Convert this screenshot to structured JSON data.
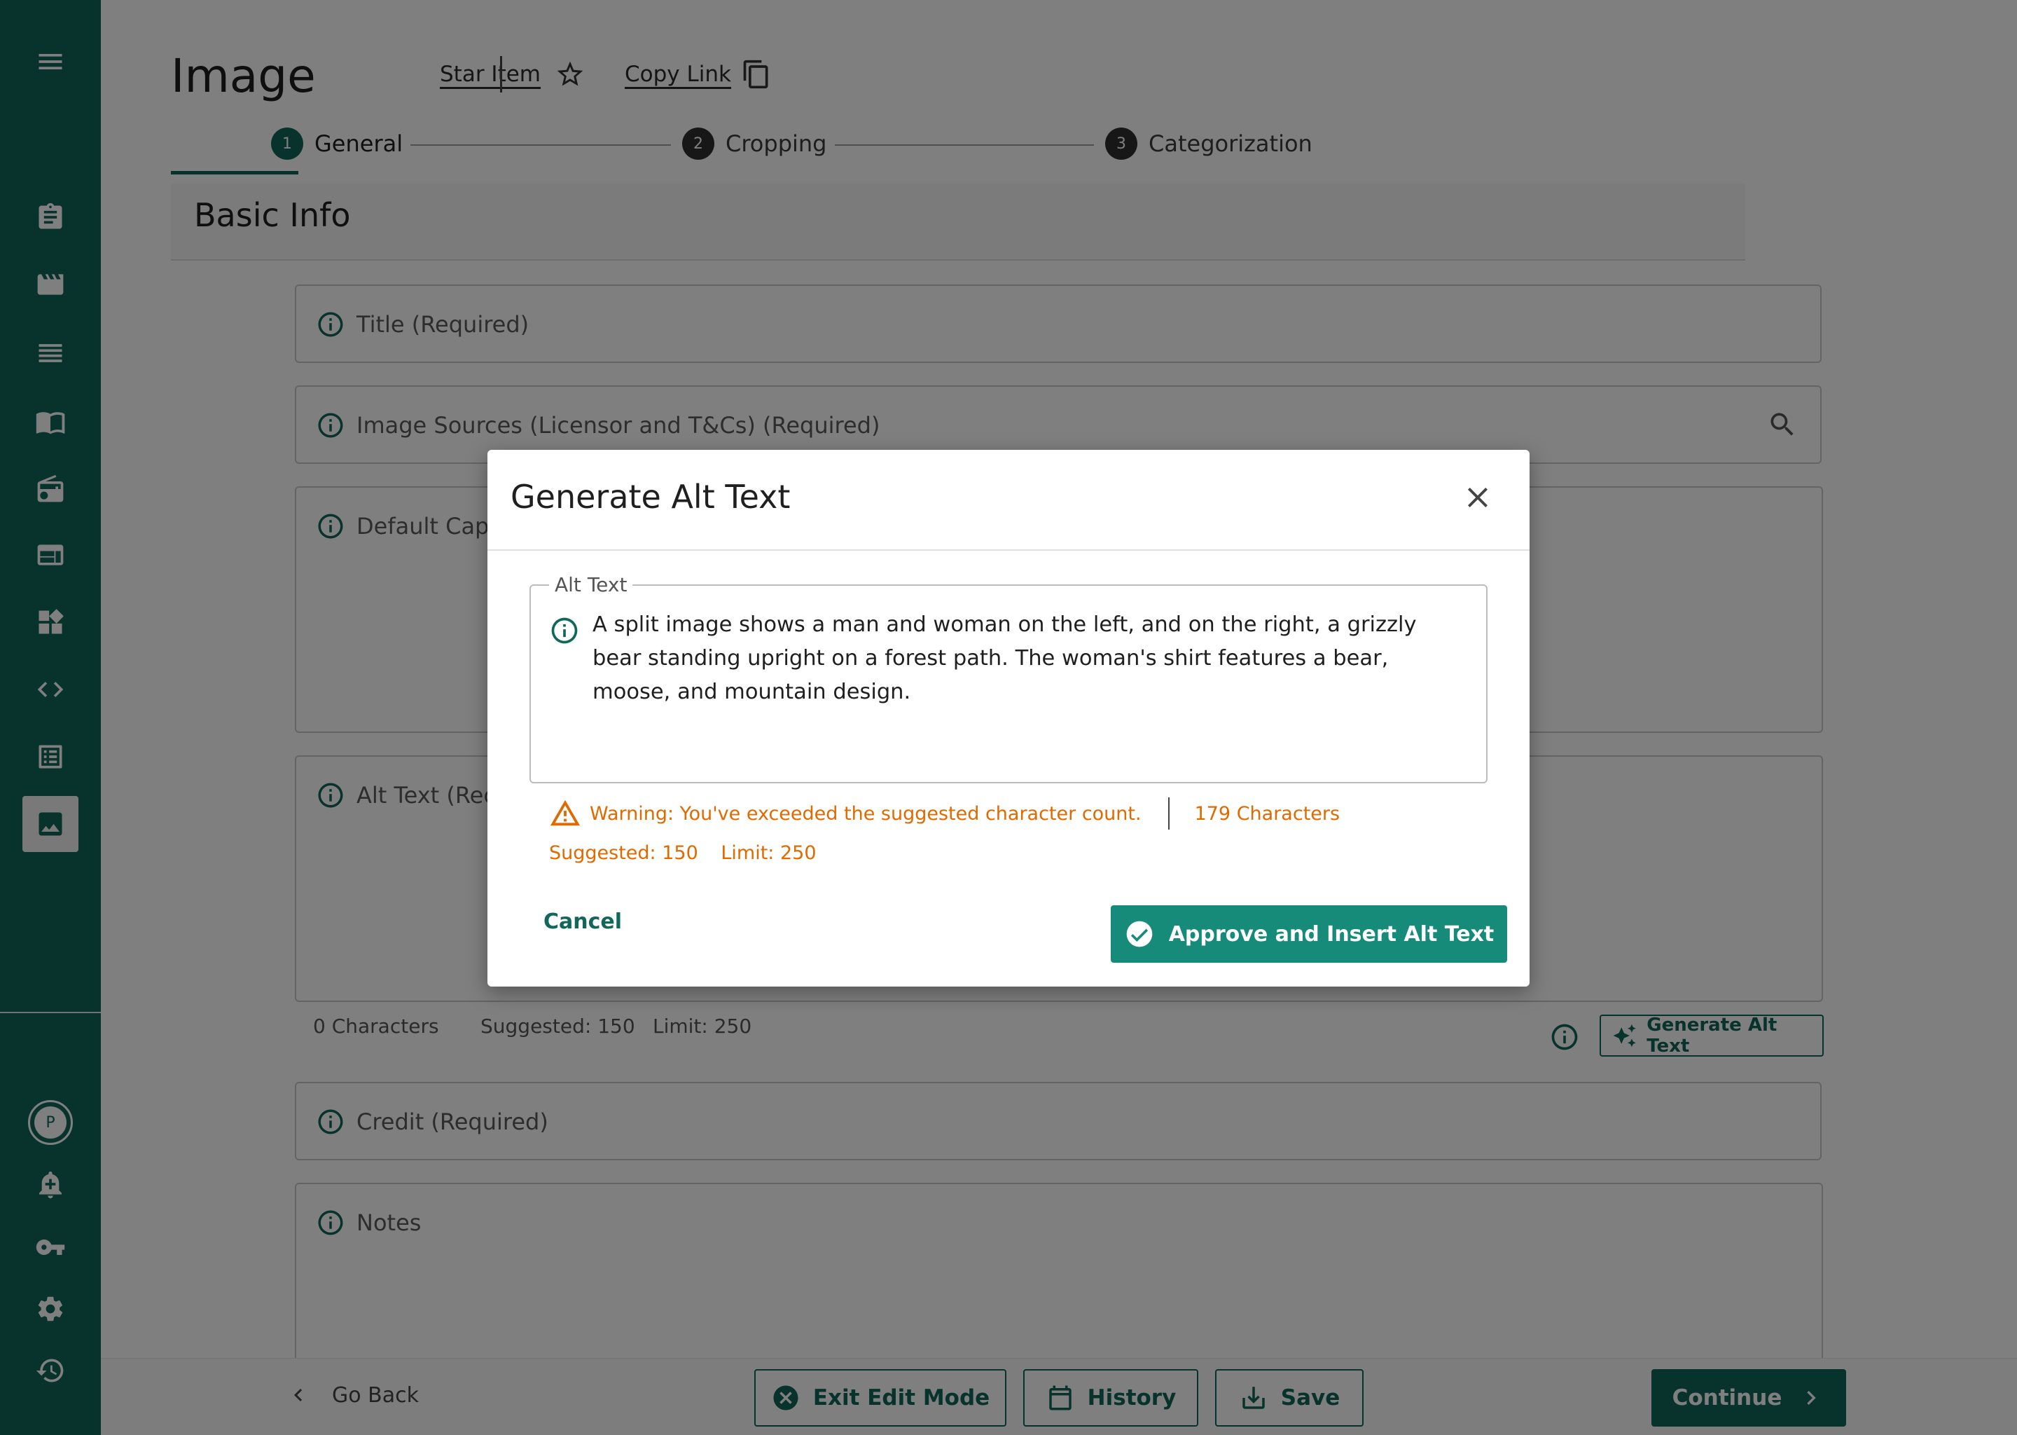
{
  "header": {
    "title": "Image",
    "star_item": "Star Item",
    "copy_link": "Copy Link"
  },
  "steps": [
    {
      "num": "1",
      "label": "General"
    },
    {
      "num": "2",
      "label": "Cropping"
    },
    {
      "num": "3",
      "label": "Categorization"
    }
  ],
  "section": {
    "title": "Basic Info"
  },
  "fields": {
    "title": "Title (Required)",
    "image_sources": "Image Sources (Licensor and T&Cs) (Required)",
    "default_caption": "Default Capt",
    "alt_text": "Alt Text (Rec",
    "credit": "Credit (Required)",
    "notes": "Notes"
  },
  "alt_meta": {
    "characters": "0 Characters",
    "suggested": "Suggested:  150",
    "limit": "Limit: 250",
    "generate_button": "Generate Alt Text"
  },
  "sidebar": {
    "avatar_initial": "P",
    "icons": [
      "menu-icon",
      "clipboard-icon",
      "movie-icon",
      "list-icon",
      "book-icon",
      "radio-icon",
      "web-icon",
      "dashboard-icon",
      "code-icon",
      "form-icon",
      "image-icon",
      "add-alert-icon",
      "key-icon",
      "settings-icon",
      "history-icon"
    ]
  },
  "footer": {
    "go_back": "Go Back",
    "exit_edit": "Exit Edit Mode",
    "history": "History",
    "save": "Save",
    "continue": "Continue"
  },
  "modal": {
    "title": "Generate Alt Text",
    "field_label": "Alt Text",
    "alt_text_value": "A split image shows a man and woman on the left, and on the right, a grizzly bear standing upright on a forest path. The woman's shirt features a bear, moose, and mountain design.",
    "warning": "Warning: You've exceeded the suggested character count.",
    "char_count": "179 Characters",
    "suggested": "Suggested: 150",
    "limit": "Limit: 250",
    "cancel": "Cancel",
    "approve": "Approve and Insert Alt Text"
  },
  "colors": {
    "brand": "#116759",
    "approve": "#168b7a",
    "warning": "#e06a00"
  }
}
